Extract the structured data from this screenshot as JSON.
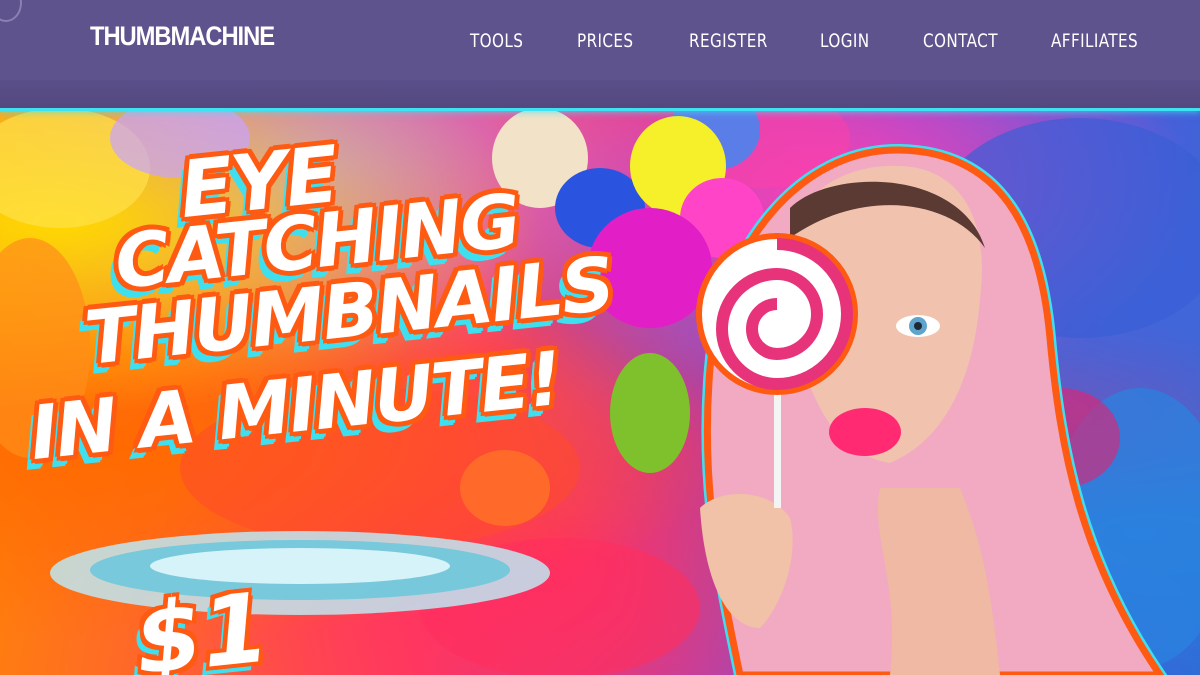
{
  "header": {
    "logo": "THUMBMACHINE",
    "nav": [
      {
        "label": "TOOLS"
      },
      {
        "label": "PRICES"
      },
      {
        "label": "REGISTER"
      },
      {
        "label": "LOGIN"
      },
      {
        "label": "CONTACT"
      },
      {
        "label": "AFFILIATES"
      }
    ],
    "colors": {
      "bar": "#5f538e",
      "accent": "#3fe2f2"
    }
  },
  "hero": {
    "headline": [
      "EYE",
      "CATCHING",
      "THUMBNAILS",
      "IN A MINUTE!"
    ],
    "price": "$1",
    "colors": {
      "outline": "#ff5a12",
      "shadow": "#3ee0f0"
    }
  }
}
